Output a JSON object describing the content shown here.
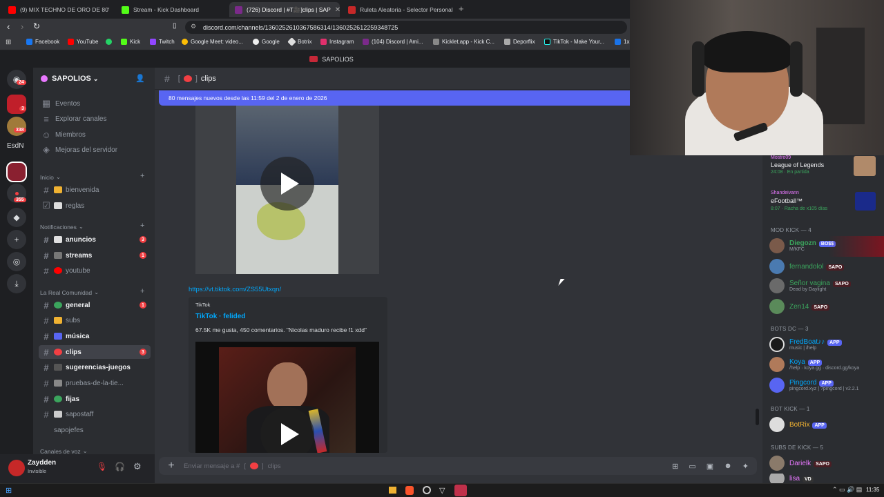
{
  "browser": {
    "tabs": [
      {
        "label": "(9) MIX TECHNO DE ORO DE 80'",
        "color": "#ff0000"
      },
      {
        "label": "Stream - Kick Dashboard",
        "color": "#53fc18"
      },
      {
        "label": "(726) Discord | #T🎥]clips | SAP",
        "color": "#7b2a8a"
      },
      {
        "label": "Ruleta Aleatoria - Selector Personaliz",
        "color": "#c62828"
      }
    ],
    "url": "discord.com/channels/1360252610367586314/1360252612259348725",
    "bookmarks": [
      "Facebook",
      "YouTube",
      "Kick",
      "Twitch",
      "Google Meet: video...",
      "Google",
      "Botrix",
      "Instagram",
      "(104) Discord | Ami...",
      "Kicklet.app - Kick C...",
      "Deporflix",
      "TikTok - Make Your...",
      "1x"
    ]
  },
  "server": {
    "name": "SAPOLIOS",
    "top_title": "SAPOLIOS",
    "badges": [
      "24",
      "3",
      "338",
      "355"
    ],
    "esdn": "EsdN"
  },
  "sidebar": {
    "menu": [
      "Eventos",
      "Explorar canales",
      "Miembros",
      "Mejoras del servidor"
    ],
    "cat_inicio": "Inicio",
    "inicio": [
      {
        "name": "bienvenida"
      },
      {
        "name": "reglas"
      }
    ],
    "cat_notif": "Notificaciones",
    "notif": [
      {
        "name": "anuncios",
        "badge": "3"
      },
      {
        "name": "streams",
        "badge": "1"
      },
      {
        "name": "youtube",
        "badge": ""
      }
    ],
    "cat_real": "La Real Comunidad",
    "real": [
      {
        "name": "general",
        "badge": "1"
      },
      {
        "name": "subs",
        "badge": ""
      },
      {
        "name": "música",
        "badge": ""
      },
      {
        "name": "clips",
        "badge": "3"
      },
      {
        "name": "sugerencias-juegos",
        "badge": ""
      },
      {
        "name": "pruebas-de-la-tie...",
        "badge": ""
      },
      {
        "name": "fijas",
        "badge": ""
      },
      {
        "name": "sapostaff",
        "badge": ""
      },
      {
        "name": "sapojefes",
        "badge": ""
      }
    ],
    "cat_voz": "Canales de voz"
  },
  "user": {
    "name": "Zaydden",
    "status": "Invisible"
  },
  "channel": {
    "name": "clips",
    "new_messages": "80 mensajes nuevos desde las 11:59 del 2 de enero de 2026",
    "link": "https://vt.tiktok.com/ZS55Utxqn/",
    "embed_provider": "TikTok",
    "embed_title": "TikTok · felided",
    "embed_desc": "67.5K me gusta, 450 comentarios. \"Nicolas maduro recibe f1 xdd\"",
    "composer_placeholder": "Enviar mensaje a #",
    "composer_channel": "clips"
  },
  "members": {
    "activities": [
      {
        "user": "Mostro09",
        "game": "League of Legends",
        "detail": "24:08 · En partida"
      },
      {
        "user": "Shandeivann",
        "game": "eFootball™",
        "detail": "8:07 · Racha de x105 días"
      }
    ],
    "groups": [
      {
        "title": "MOD KICK — 4",
        "users": [
          {
            "name": "Diegozn",
            "tag": "BO$$",
            "sub": "M/KFC",
            "color": "#3ba55d"
          },
          {
            "name": "fernandolol",
            "tag": "SAPO",
            "sub": "",
            "color": "#3ba55d"
          },
          {
            "name": "Señor vagina",
            "tag": "SAPO",
            "sub": "Dead by Daylight",
            "color": "#3ba55d"
          },
          {
            "name": "Zen14",
            "tag": "SAPO",
            "sub": "",
            "color": "#3ba55d"
          }
        ]
      },
      {
        "title": "BOTS DC — 3",
        "users": [
          {
            "name": "FredBoat♪♪",
            "tag": "APP",
            "sub": "music | /help",
            "color": "#00a8fc"
          },
          {
            "name": "Koya",
            "tag": "APP",
            "sub": "/help · koya.gg · discord.gg/koya",
            "color": "#00a8fc"
          },
          {
            "name": "Pingcord",
            "tag": "APP",
            "sub": "pingcord.xyz | ?pingcord | v2.2.1",
            "color": "#00a8fc"
          }
        ]
      },
      {
        "title": "BOT KICK — 1",
        "users": [
          {
            "name": "BotRix",
            "tag": "APP",
            "sub": "",
            "color": "#f0b232"
          }
        ]
      },
      {
        "title": "SUBS DE KICK — 5",
        "users": [
          {
            "name": "Darielk",
            "tag": "SAPO",
            "sub": "",
            "color": "#e978ff"
          },
          {
            "name": "lisa",
            "tag": "VD",
            "sub": "",
            "color": "#e978ff"
          }
        ]
      }
    ]
  },
  "taskbar": {
    "time": "11:35"
  }
}
